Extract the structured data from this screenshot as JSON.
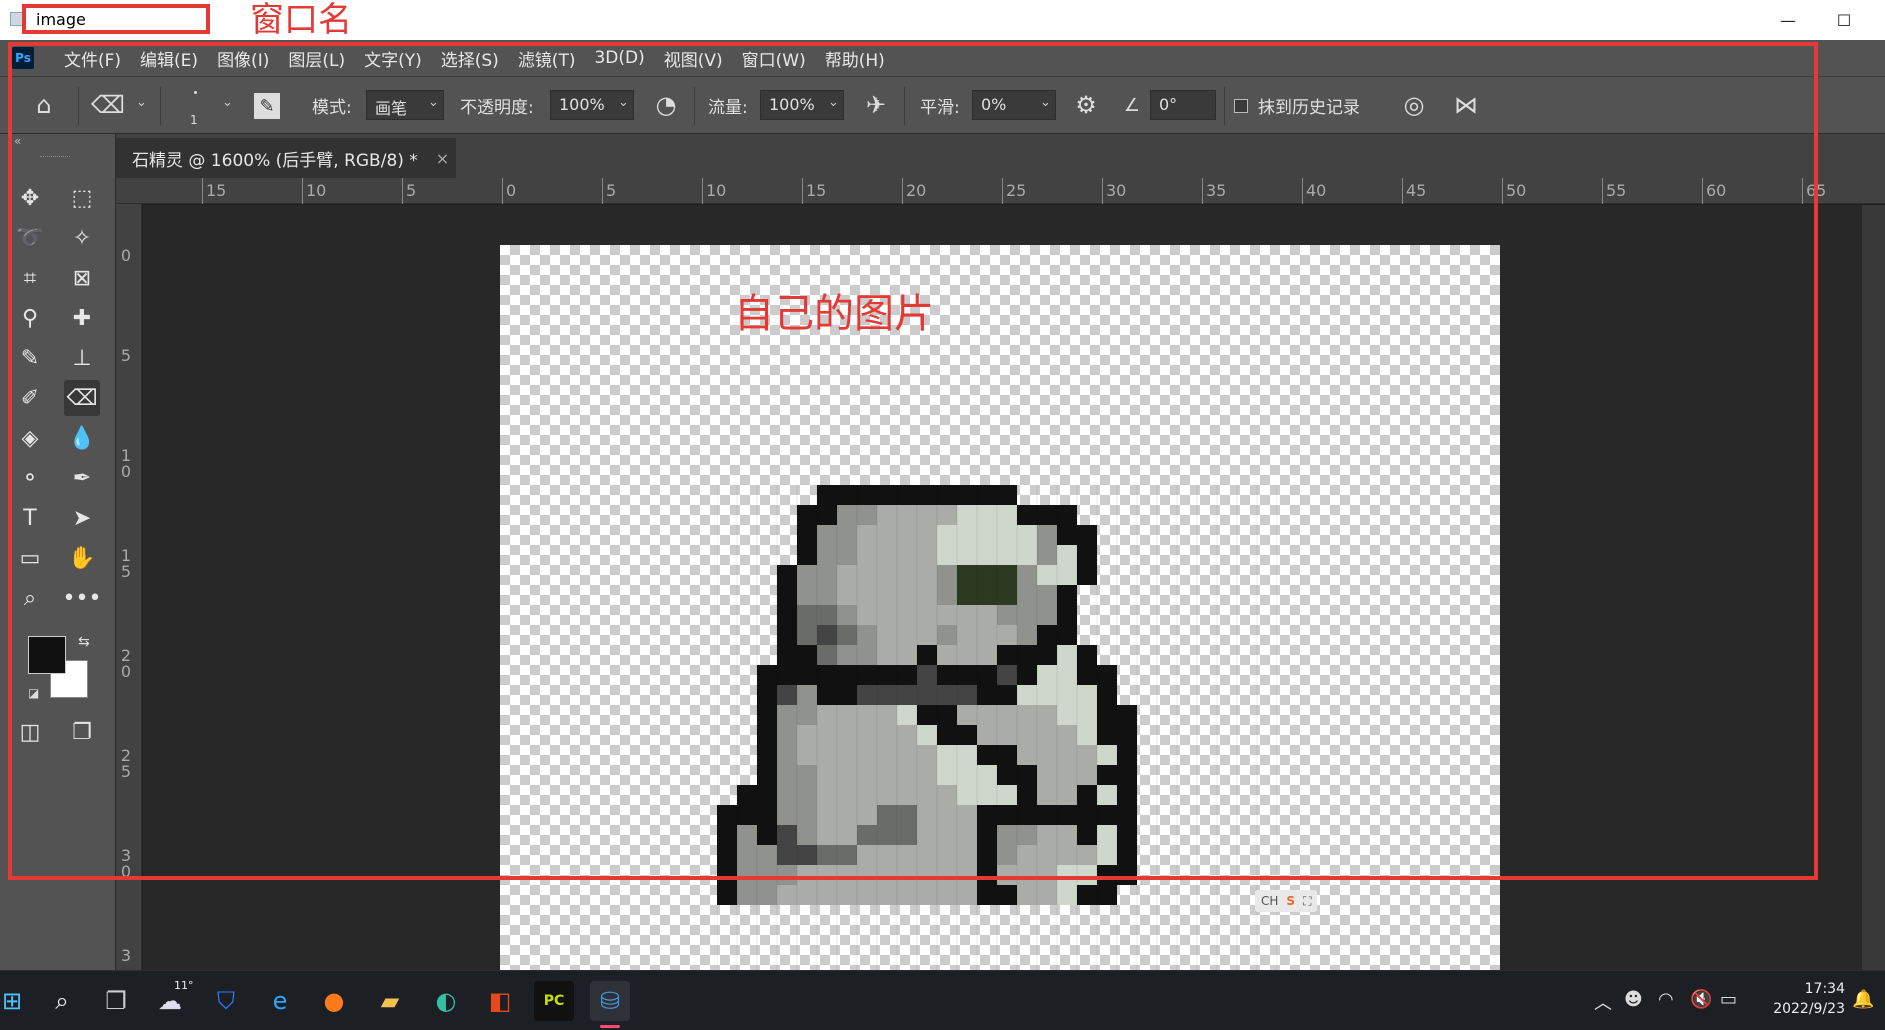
{
  "window": {
    "title": "image",
    "annotation": "窗口名",
    "minimize_glyph": "—",
    "maximize_glyph": "☐"
  },
  "menubar": {
    "app_badge": "Ps",
    "items": [
      "文件(F)",
      "编辑(E)",
      "图像(I)",
      "图层(L)",
      "文字(Y)",
      "选择(S)",
      "滤镜(T)",
      "3D(D)",
      "视图(V)",
      "窗口(W)",
      "帮助(H)"
    ]
  },
  "options_bar": {
    "brush_size": "1",
    "mode_label": "模式:",
    "mode_value": "画笔",
    "opacity_label": "不透明度:",
    "opacity_value": "100%",
    "flow_label": "流量:",
    "flow_value": "100%",
    "smoothing_label": "平滑:",
    "smoothing_value": "0%",
    "angle_value": "0°",
    "erase_history_label": "抹到历史记录"
  },
  "document": {
    "tab_title": "石精灵 @ 1600% (后手臂, RGB/8) *",
    "tab_close": "×",
    "canvas_annotation": "自己的图片"
  },
  "rulers": {
    "horizontal": [
      "15",
      "10",
      "5",
      "0",
      "5",
      "10",
      "15",
      "20",
      "25",
      "30",
      "35",
      "40",
      "45",
      "50",
      "55",
      "60",
      "65"
    ],
    "vertical": [
      "0",
      "5",
      "1 0",
      "1 5",
      "2 0",
      "2 5",
      "3 0",
      "3"
    ]
  },
  "ime": {
    "lang": "CH",
    "logo": "S"
  },
  "taskbar": {
    "weather": "11°",
    "time": "17:34",
    "date": "2022/9/23"
  },
  "colors": {
    "annotation_red": "#e53935",
    "ps_panel": "#535353",
    "ps_canvas_bg": "#282828",
    "ps_blue": "#31a8ff"
  }
}
